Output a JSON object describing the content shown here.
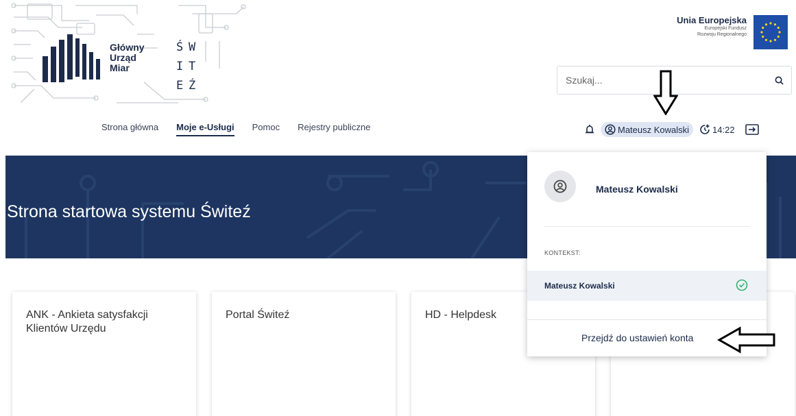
{
  "logo": {
    "line1": "Główny",
    "line2": "Urząd",
    "line3": "Miar",
    "switez_letters": [
      "Ś",
      "W",
      "I",
      "T",
      "E",
      "Ź"
    ]
  },
  "eu": {
    "title": "Unia Europejska",
    "sub1": "Europejski Fundusz",
    "sub2": "Rozwoju Regionalnego",
    "flag_color": "#1f4ea8"
  },
  "search": {
    "placeholder": "Szukaj...",
    "icon": "search-icon"
  },
  "nav": {
    "items": [
      {
        "label": "Strona główna",
        "active": false
      },
      {
        "label": "Moje e-Usługi",
        "active": true
      },
      {
        "label": "Pomoc",
        "active": false
      },
      {
        "label": "Rejestry publiczne",
        "active": false
      }
    ]
  },
  "userbar": {
    "user_name": "Mateusz Kowalski",
    "session_time": "14:22",
    "bell_icon": "bell-icon",
    "logout_icon": "logout-icon"
  },
  "banner": {
    "title": "Strona startowa systemu Świteź",
    "color": "#1d3560"
  },
  "cards": [
    {
      "title": "ANK - Ankieta satysfakcji Klientów Urzędu"
    },
    {
      "title": "Portal Świteź"
    },
    {
      "title": "HD - Helpdesk"
    },
    {
      "title": ""
    }
  ],
  "dropdown": {
    "user_name": "Mateusz Kowalski",
    "context_label": "KONTEKST:",
    "context_item": "Mateusz Kowalski",
    "settings_link": "Przejdź do ustawień konta",
    "check_color": "#2fb36b"
  }
}
